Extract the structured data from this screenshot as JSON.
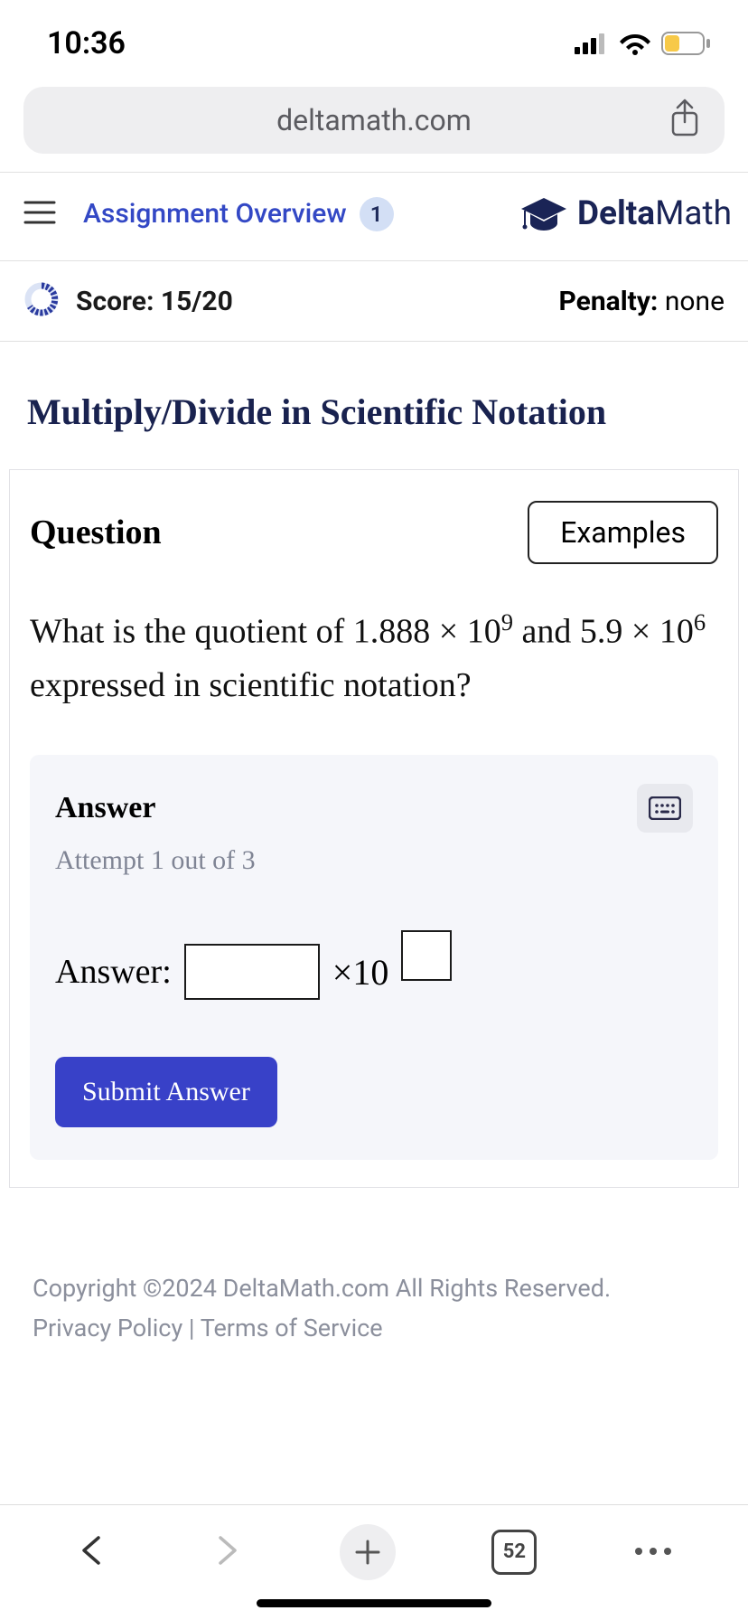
{
  "status": {
    "time": "10:36"
  },
  "browser": {
    "url": "deltamath.com",
    "tab_count": "52"
  },
  "header": {
    "assignment_link": "Assignment Overview",
    "badge": "1",
    "logo_bold": "Delta",
    "logo_rest": "Math"
  },
  "score": {
    "label": "Score: 15/20",
    "penalty_label": "Penalty: ",
    "penalty_value": "none"
  },
  "page_title": "Multiply/Divide in Scientific Notation",
  "question": {
    "heading": "Question",
    "examples_btn": "Examples",
    "text_1": "What is the quotient of ",
    "num1_coef": "1.888",
    "times": " × ",
    "ten": "10",
    "num1_exp": "9",
    "text_and": " and ",
    "num2_coef": "5.9",
    "num2_exp": "6",
    "text_2": " expressed in scientific notation?"
  },
  "answer": {
    "heading": "Answer",
    "attempt": "Attempt 1 out of 3",
    "prefix": "Answer:",
    "times10": "×10",
    "submit": "Submit Answer"
  },
  "footer": {
    "copyright": "Copyright ©2024 DeltaMath.com All Rights Reserved.",
    "privacy": "Privacy Policy",
    "sep": " | ",
    "terms": "Terms of Service"
  }
}
